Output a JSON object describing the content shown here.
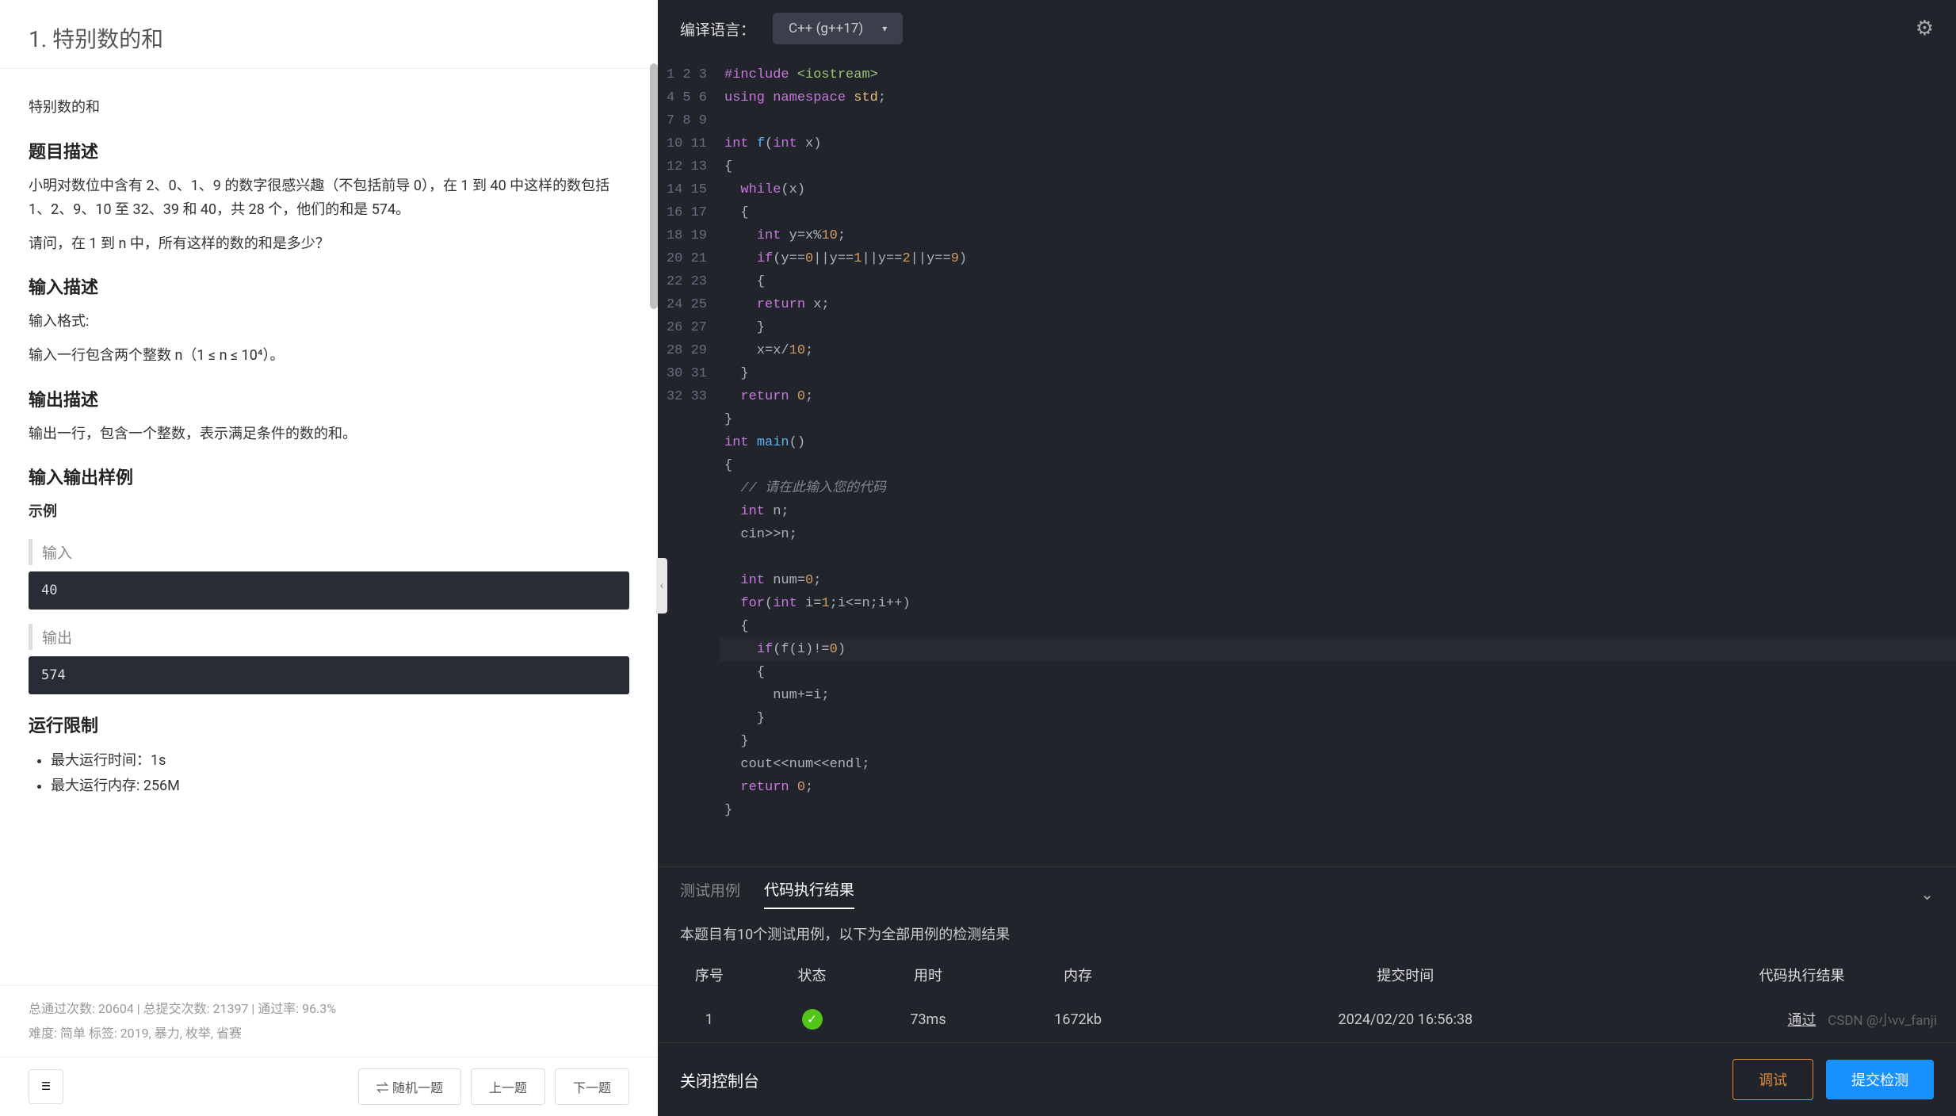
{
  "problem": {
    "number_title": "1. 特别数的和",
    "title": "特别数的和",
    "desc_heading": "题目描述",
    "desc_p1": "小明对数位中含有 2、0、1、9 的数字很感兴趣（不包括前导 0），在 1 到 40 中这样的数包括 1、2、9、10 至 32、39 和 40，共 28 个，他们的和是 574。",
    "desc_p2": "请问，在 1 到 n 中，所有这样的数的和是多少？",
    "input_heading": "输入描述",
    "input_format_label": "输入格式:",
    "input_desc": "输入一行包含两个整数 n（1 ≤ n ≤ 10⁴）。",
    "output_heading": "输出描述",
    "output_desc": "输出一行，包含一个整数，表示满足条件的数的和。",
    "sample_heading": "输入输出样例",
    "sample_label": "示例",
    "input_label": "输入",
    "input_value": "40",
    "output_label": "输出",
    "output_value": "574",
    "limits_heading": "运行限制",
    "limit_time": "最大运行时间：1s",
    "limit_mem": "最大运行内存: 256M",
    "stats_line": "总通过次数: 20604  |  总提交次数: 21397  |  通过率: 96.3%",
    "meta_line": "难度: 简单    标签: 2019, 暴力, 枚举, 省赛"
  },
  "nav": {
    "random": "⇌ 随机一题",
    "prev": "上一题",
    "next": "下一题"
  },
  "editor": {
    "compiler_label": "编译语言：",
    "language": "C++ (g++17)",
    "lines": 33
  },
  "results": {
    "tab_testcase": "测试用例",
    "tab_result": "代码执行结果",
    "note": "本题目有10个测试用例，以下为全部用例的检测结果",
    "headers": {
      "no": "序号",
      "status": "状态",
      "time": "用时",
      "mem": "内存",
      "submitted": "提交时间",
      "result": "代码执行结果"
    },
    "row": {
      "no": "1",
      "time": "73ms",
      "mem": "1672kb",
      "submitted": "2024/02/20 16:56:38",
      "result": "通过"
    }
  },
  "actions": {
    "close": "关闭控制台",
    "debug": "调试",
    "submit": "提交检测"
  },
  "watermark": "CSDN @小vv_fanji"
}
